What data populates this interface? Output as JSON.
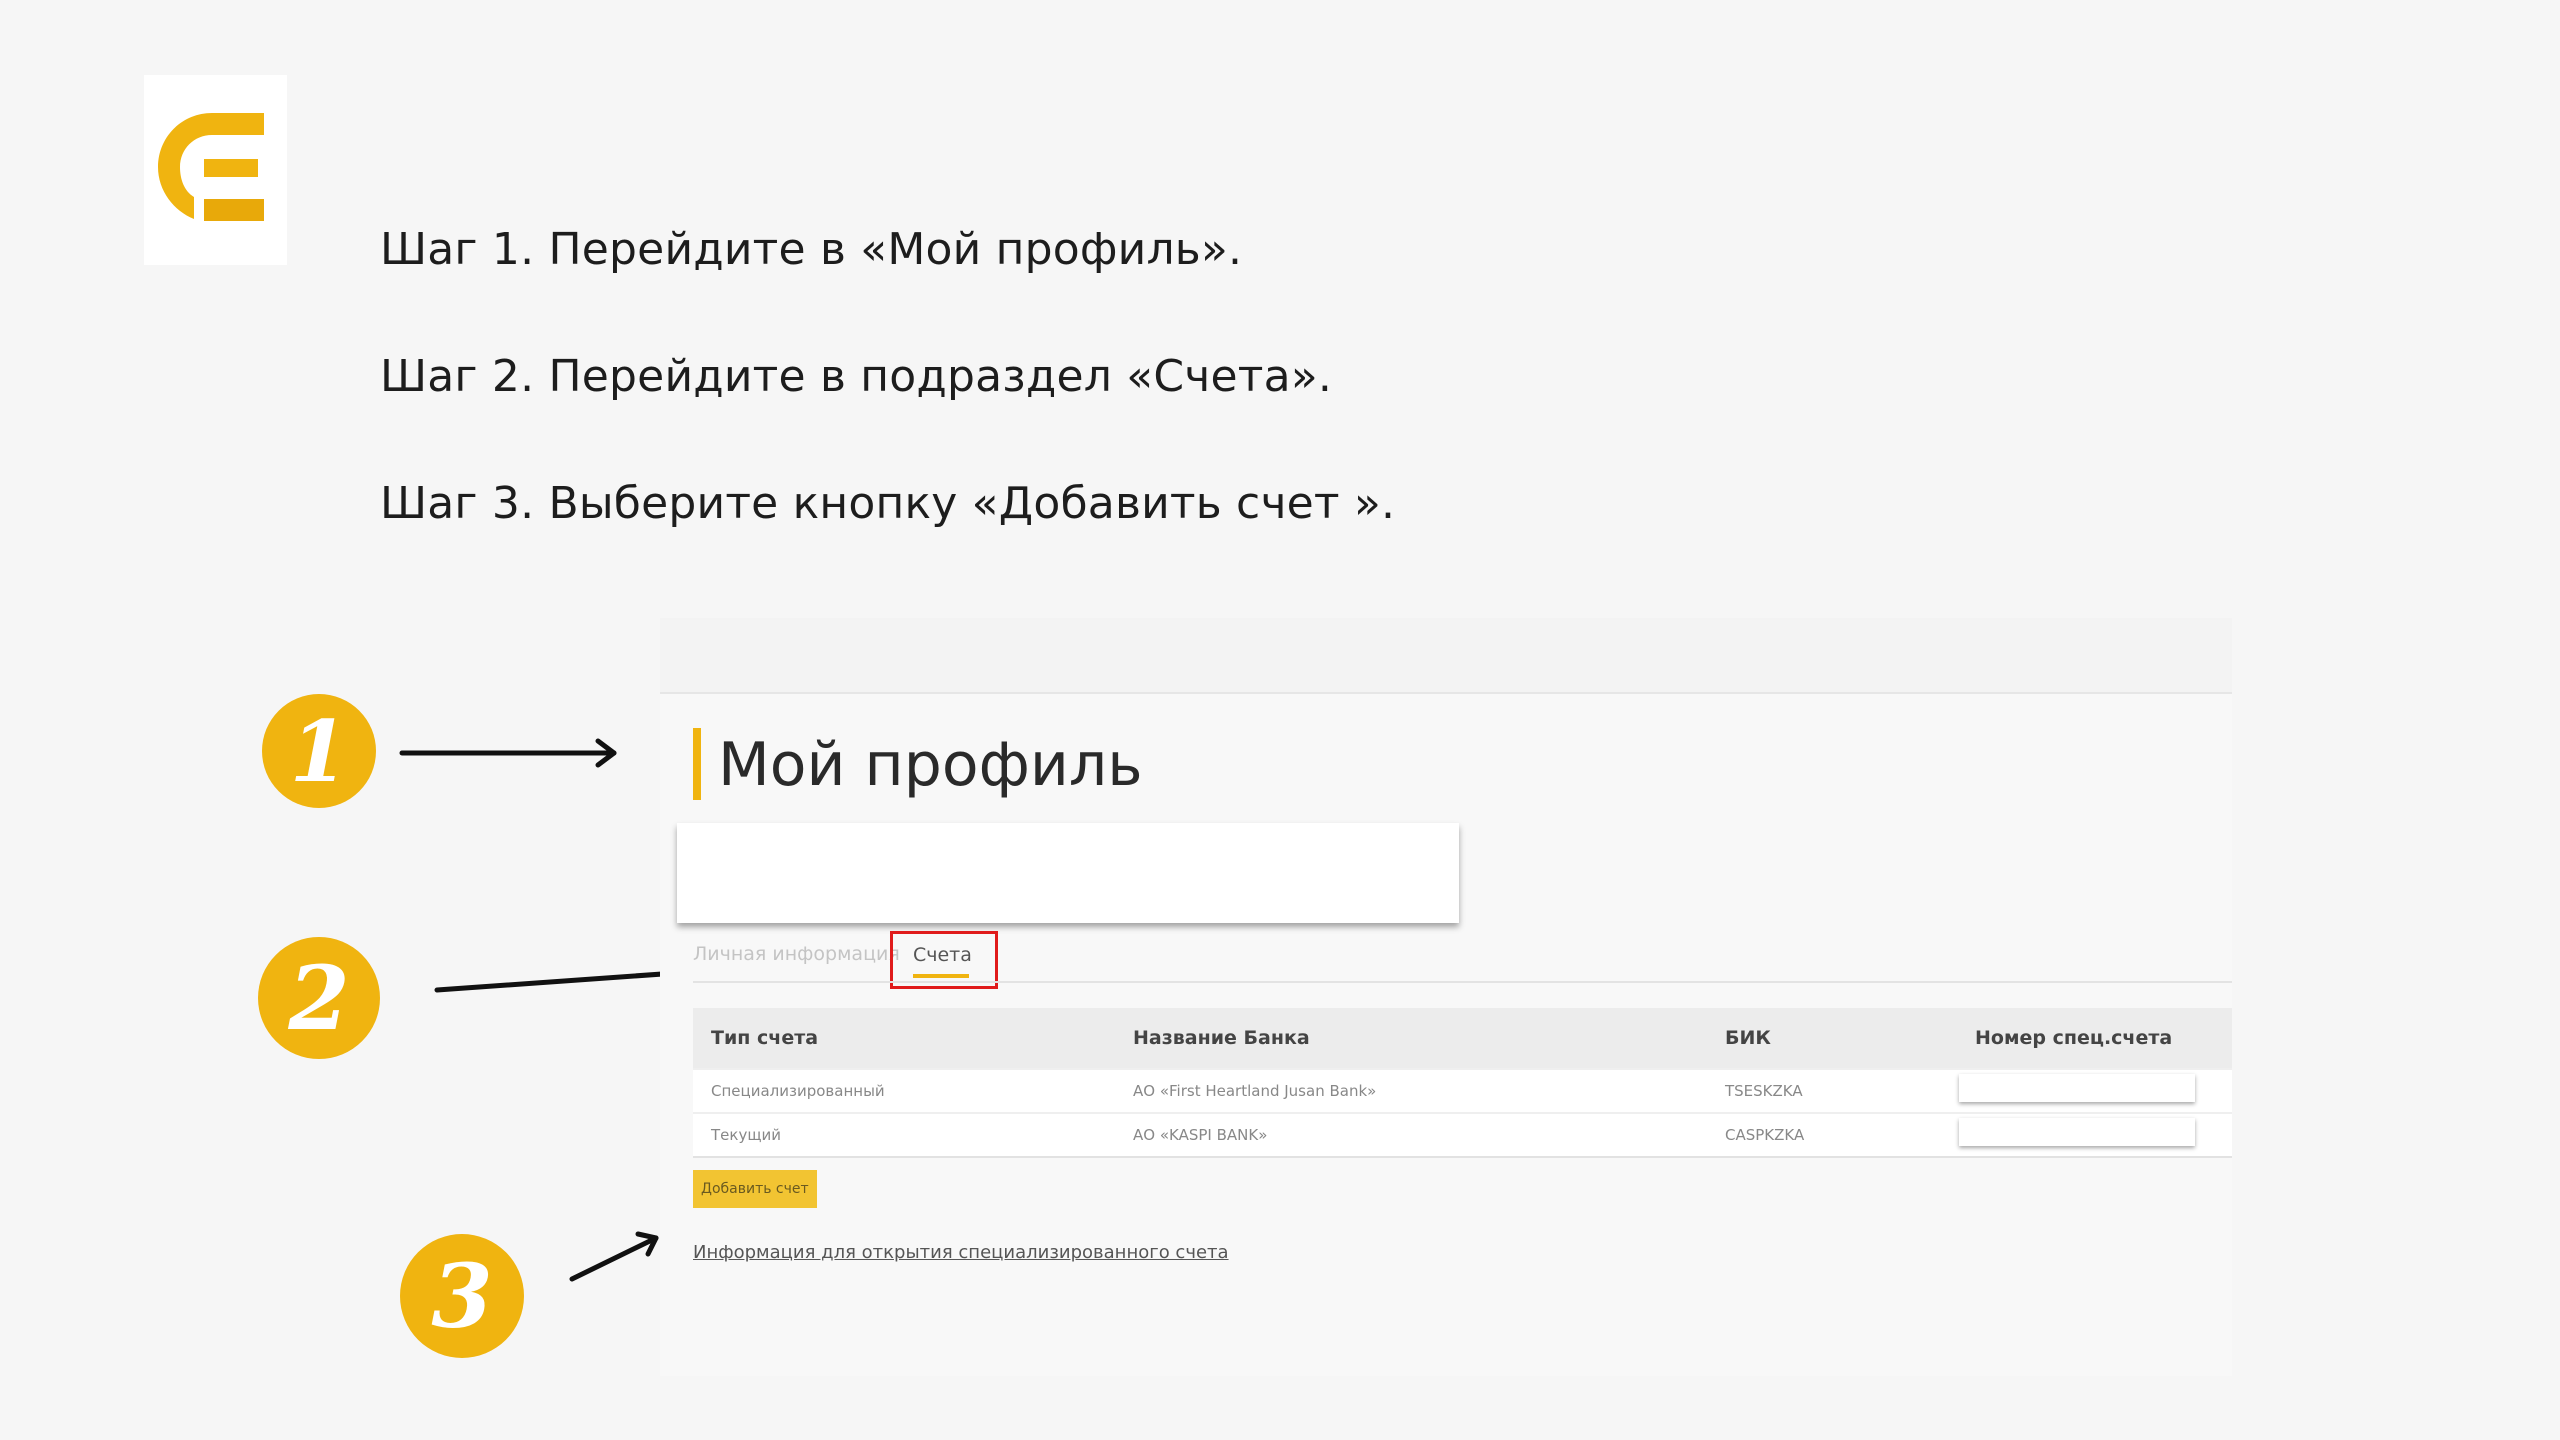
{
  "instructions": {
    "steps": [
      "Шаг 1. Перейдите в  «Мой профиль».",
      "Шаг 2. Перейдите в подраздел «Счета».",
      "Шаг 3. Выберите кнопку «Добавить счет »."
    ]
  },
  "markers": [
    "1",
    "2",
    "3"
  ],
  "colors": {
    "accent": "#f0b410",
    "highlight": "#e01b1b"
  },
  "screenshot": {
    "page_title": "Мой профиль",
    "tabs": [
      {
        "label": "Личная информация",
        "active": false
      },
      {
        "label": "Счета",
        "active": true
      }
    ],
    "table": {
      "headers": [
        "Тип счета",
        "Название Банка",
        "БИК",
        "Номер спец.счета"
      ],
      "rows": [
        {
          "type": "Специализированный",
          "bank": "АО «First Heartland Jusan Bank»",
          "bik": "TSESKZKA"
        },
        {
          "type": "Текущий",
          "bank": "АО «KASPI BANK»",
          "bik": "CASPKZKA"
        }
      ]
    },
    "add_button": "Добавить счет",
    "info_link": "Информация для открытия специализированного счета"
  }
}
